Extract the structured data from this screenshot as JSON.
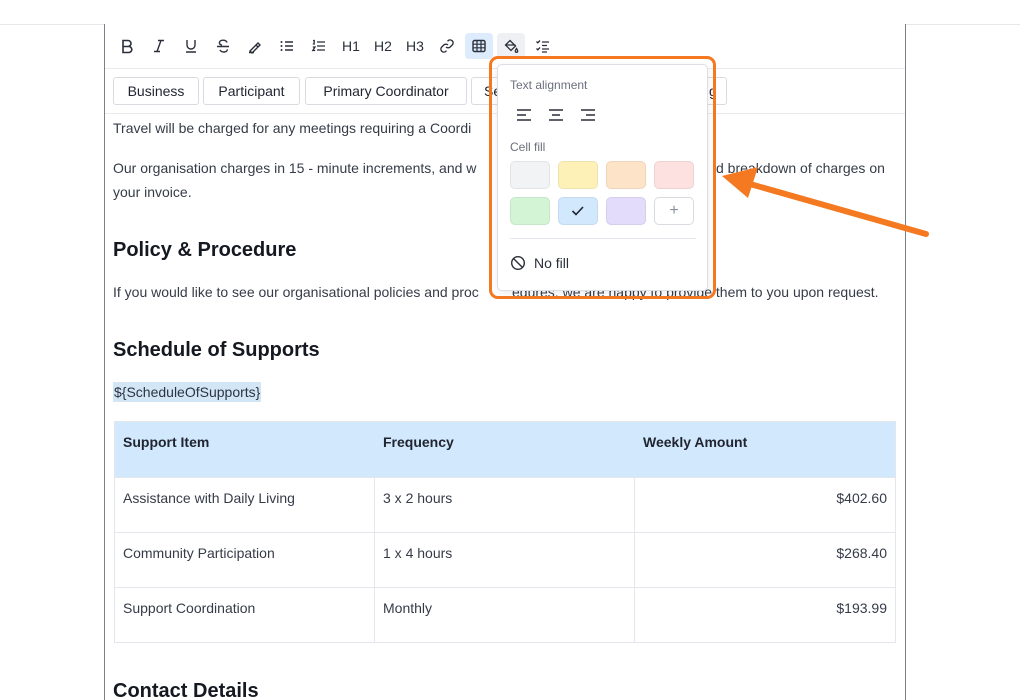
{
  "toolbar": {
    "h1": "H1",
    "h2": "H2",
    "h3": "H3"
  },
  "chips": [
    "Business",
    "Participant",
    "Primary Coordinator",
    "Se",
    "g"
  ],
  "document": {
    "travel_text": "Travel will be charged for any meetings requiring a Coordi",
    "increments_line1_start": "Our organisation charges in 15 - minute increments, and w",
    "increments_line1_end": "d breakdown of charges on",
    "increments_line2": "your invoice.",
    "policy_heading": "Policy & Procedure",
    "policy_text_start": "If you would like to see our organisational policies and proc",
    "policy_text_end": "edures, we are happy to provide them to you upon request.",
    "schedule_heading": "Schedule of Supports",
    "placeholder": "${ScheduleOfSupports}",
    "contact_heading": "Contact Details"
  },
  "table": {
    "headers": [
      "Support Item",
      "Frequency",
      "Weekly Amount"
    ],
    "rows": [
      [
        "Assistance with Daily Living",
        "3 x 2 hours",
        "$402.60"
      ],
      [
        "Community Participation",
        "1 x 4 hours",
        "$268.40"
      ],
      [
        "Support Coordination",
        "Monthly",
        "$193.99"
      ]
    ]
  },
  "popover": {
    "alignment_label": "Text alignment",
    "cell_fill_label": "Cell fill",
    "swatches": [
      {
        "color": "#f2f3f5",
        "selected": false
      },
      {
        "color": "#fdf1b8",
        "selected": false
      },
      {
        "color": "#fde3c8",
        "selected": false
      },
      {
        "color": "#fde0e0",
        "selected": false
      },
      {
        "color": "#d3f5d6",
        "selected": false
      },
      {
        "color": "#d2e8fc",
        "selected": true
      },
      {
        "color": "#e3dcfb",
        "selected": false
      }
    ],
    "add_label": "+",
    "no_fill_label": "No fill"
  },
  "colors": {
    "accent_orange": "#f47920",
    "selection_blue": "#d2e8fc"
  }
}
